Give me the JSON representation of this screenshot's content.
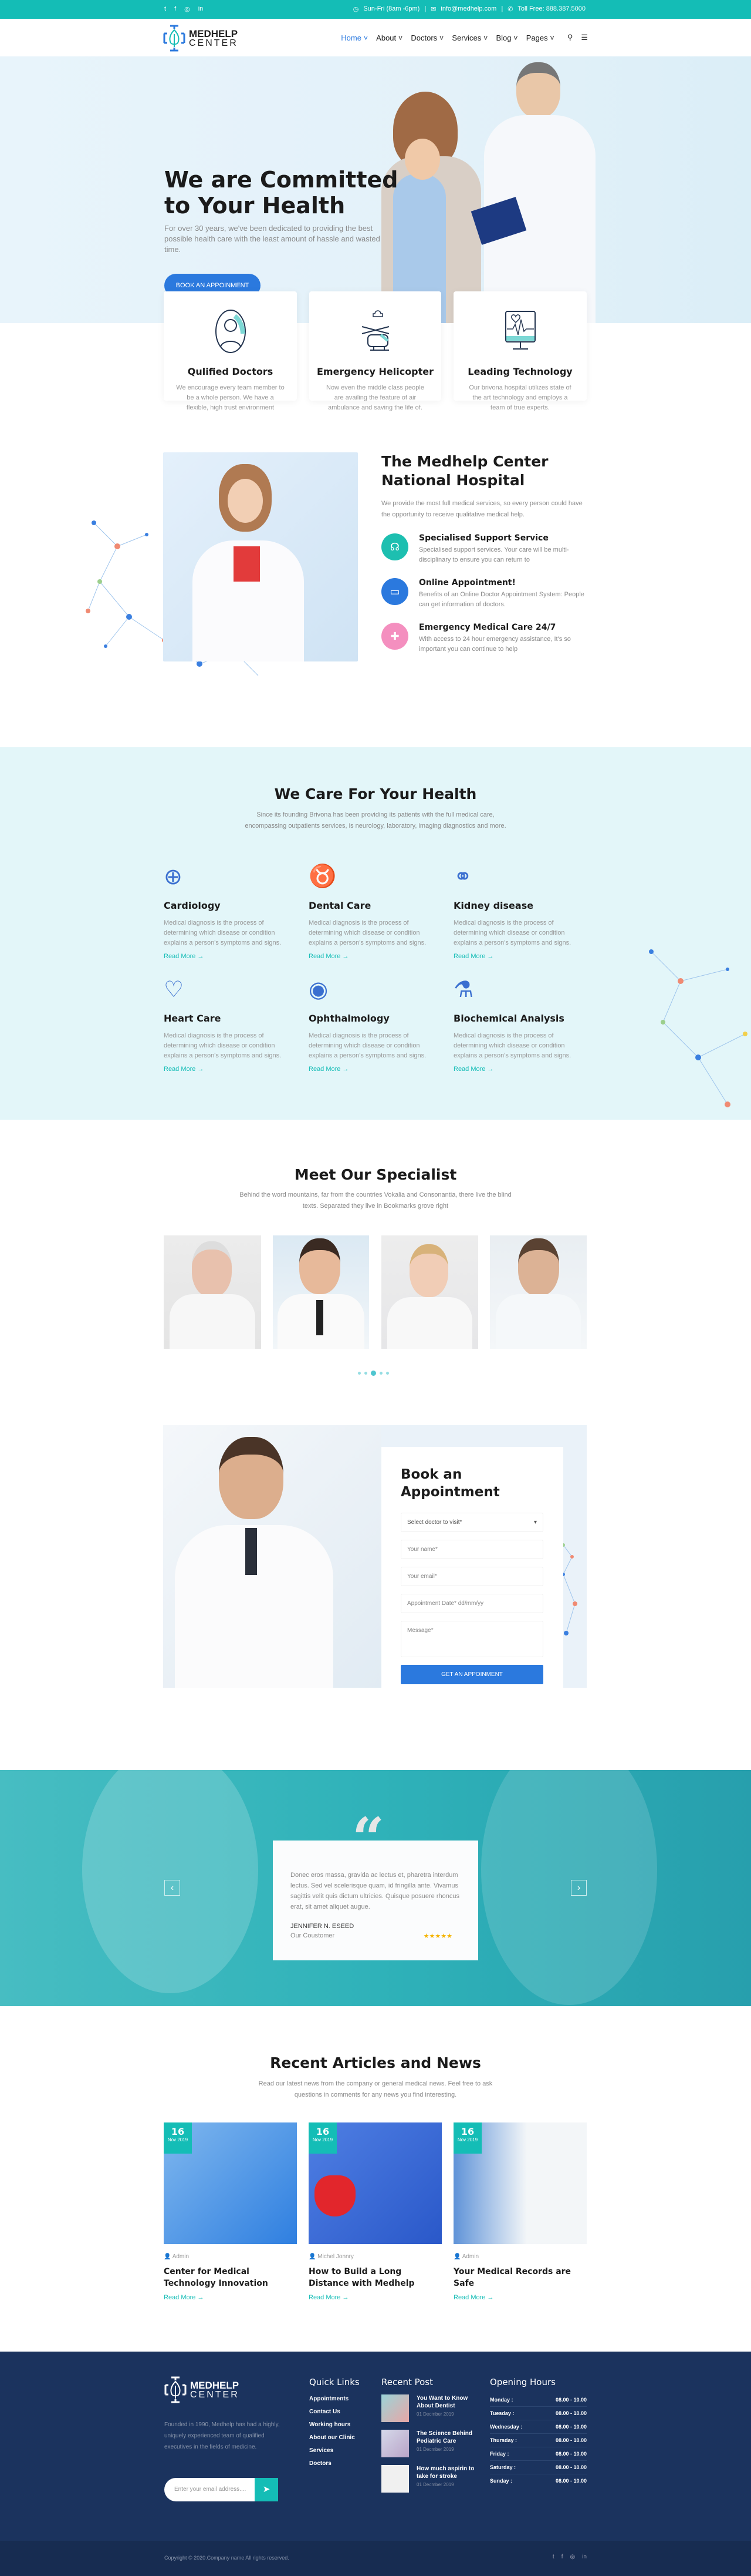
{
  "topbar": {
    "social": [
      "t",
      "f",
      "◎",
      "in"
    ],
    "hours": "Sun-Fri (8am -6pm)",
    "email": "info@medhelp.com",
    "phone": "Toll Free: 888.387.5000"
  },
  "header": {
    "logo_line1": "MEDHELP",
    "logo_line2": "CENTER",
    "nav": [
      "Home",
      "About",
      "Doctors",
      "Services",
      "Blog",
      "Pages"
    ],
    "active": "Home"
  },
  "hero": {
    "title_line1": "We are Committed",
    "title_line2": "to Your Health",
    "text": "For over 30 years, we've been dedicated to providing the best possible health care with the least amount of hassle and wasted time.",
    "button": "BOOK AN APPOINMENT"
  },
  "features": [
    {
      "icon": "doctor-icon",
      "title": "Qulified Doctors",
      "text": "We encourage every team member to be a whole person. We have a flexible, high trust environment"
    },
    {
      "icon": "helicopter-icon",
      "title": "Emergency Helicopter",
      "text": "Now even the middle class people are availing the feature of air ambulance and saving the life of."
    },
    {
      "icon": "monitor-heart-icon",
      "title": "Leading Technology",
      "text": "Our brivona hospital utilizes state of the art technology and employs a team of true experts."
    }
  ],
  "about": {
    "title_line1": "The Medhelp Center",
    "title_line2": "National Hospital",
    "text": "We provide the most full medical services, so every person could have the opportunity to receive qualitative medical help.",
    "items": [
      {
        "icon": "support-icon",
        "color": "#1dbfb0",
        "title": "Specialised Support Service",
        "text": "Specialised support services. Your care will be multi-disciplinary to ensure you can return to"
      },
      {
        "icon": "online-doctor-icon",
        "color": "#2b79de",
        "title": "Online Appointment!",
        "text": "Benefits of an Online Doctor Appointment System: People can get information of doctors."
      },
      {
        "icon": "emergency-icon",
        "color": "#f48fbf",
        "title": "Emergency Medical Care 24/7",
        "text": "With access to 24 hour emergency assistance, It's so important you can continue to help"
      }
    ]
  },
  "services": {
    "title": "We Care For Your Health",
    "text": "Since its founding Brivona has been providing its patients with the full medical care, encompassing outpatients services, is neurology, laboratory, imaging diagnostics and more.",
    "items": [
      {
        "icon": "cardiology-icon",
        "title": "Cardiology",
        "text": "Medical diagnosis is the process of determining which disease or condition explains a person's symptoms and signs.",
        "link": "Read More →"
      },
      {
        "icon": "tooth-icon",
        "title": "Dental Care",
        "text": "Medical diagnosis is the process of determining which disease or condition explains a person's symptoms and signs.",
        "link": "Read More →"
      },
      {
        "icon": "kidney-icon",
        "title": "Kidney disease",
        "text": "Medical diagnosis is the process of determining which disease or condition explains a person's symptoms and signs.",
        "link": "Read More →"
      },
      {
        "icon": "heart-hands-icon",
        "title": "Heart Care",
        "text": "Medical diagnosis is the process of determining which disease or condition explains a person's symptoms and signs.",
        "link": "Read More →"
      },
      {
        "icon": "eye-icon",
        "title": "Ophthalmology",
        "text": "Medical diagnosis is the process of determining which disease or condition explains a person's symptoms and signs.",
        "link": "Read More →"
      },
      {
        "icon": "flask-icon",
        "title": "Biochemical Analysis",
        "text": "Medical diagnosis is the process of determining which disease or condition explains a person's symptoms and signs.",
        "link": "Read More →"
      }
    ]
  },
  "specialists": {
    "title": "Meet Our Specialist",
    "text": "Behind the word mountains, far from the countries Vokalia and Consonantia, there live the blind texts. Separated they live in Bookmarks grove right",
    "dots": 5,
    "active_dot": 3
  },
  "appointment": {
    "title_line1": "Book an",
    "title_line2": "Appointment",
    "select": "Select doctor to visit*",
    "name_ph": "Your name*",
    "email_ph": "Your email*",
    "date_ph": "Appointment Date* dd/mm/yy",
    "message_ph": "Message*",
    "button": "GET AN APPOINMENT"
  },
  "testimonial": {
    "quote": "Donec eros massa, gravida ac lectus et, pharetra interdum lectus. Sed vel scelerisque quam, id fringilla ante. Vivamus sagittis velit quis dictum ultricies. Quisque posuere rhoncus erat, sit amet aliquet augue.",
    "name": "JENNIFER N. ESEED",
    "role": "Our Coustomer",
    "rating": 5,
    "prev": "‹",
    "next": "›"
  },
  "articles": {
    "title": "Recent Articles and News",
    "text": "Read our latest news from the company or general medical news. Feel free to ask questions in comments for any news you find interesting.",
    "items": [
      {
        "day": "16",
        "month": "Nov 2019",
        "author": "Admin",
        "title": "Center for Medical Technology Innovation",
        "link": "Read More →"
      },
      {
        "day": "16",
        "month": "Nov 2019",
        "author": "Michel Jonnry",
        "title": "How to Build a Long Distance with Medhelp",
        "link": "Read More →"
      },
      {
        "day": "16",
        "month": "Nov 2019",
        "author": "Admin",
        "title": "Your Medical Records are Safe",
        "link": "Read More →"
      }
    ]
  },
  "footer": {
    "logo_line1": "MEDHELP",
    "logo_line2": "CENTER",
    "about": "Founded in 1990, Medhelp has had a highly, uniquely experienced team of qualified executives in the fields of medicine.",
    "email_ph": "Enter your email address....",
    "quick_title": "Quick Links",
    "quick": [
      "Appointments",
      "Contact Us",
      "Working hours",
      "About our Clinic",
      "Services",
      "Doctors"
    ],
    "recent_title": "Recent Post",
    "recent": [
      {
        "title": "You Want to Know About Dentist",
        "date": "01 Decmber 2019"
      },
      {
        "title": "The Science Behind Pediatric Care",
        "date": "01 Decmber 2019"
      },
      {
        "title": "How much aspirin to take for stroke",
        "date": "01 Decmber 2019"
      }
    ],
    "hours_title": "Opening Hours",
    "hours": [
      {
        "day": "Monday :",
        "time": "08.00 - 10.00"
      },
      {
        "day": "Tuesday :",
        "time": "08.00 - 10.00"
      },
      {
        "day": "Wednesday :",
        "time": "08.00 - 10.00"
      },
      {
        "day": "Thursday :",
        "time": "08.00 - 10.00"
      },
      {
        "day": "Friday :",
        "time": "08.00 - 10.00"
      },
      {
        "day": "Saturday :",
        "time": "08.00 - 10.00"
      },
      {
        "day": "Sunday :",
        "time": "08.00 - 10.00"
      }
    ],
    "copyright": "Copyright © 2020.Company name All rights reserved.",
    "social": [
      "t",
      "f",
      "◎",
      "in"
    ]
  },
  "colors": {
    "teal": "#14bdb6",
    "blue": "#2b79de",
    "navy": "#1a2f55",
    "star": "#f5b301"
  }
}
